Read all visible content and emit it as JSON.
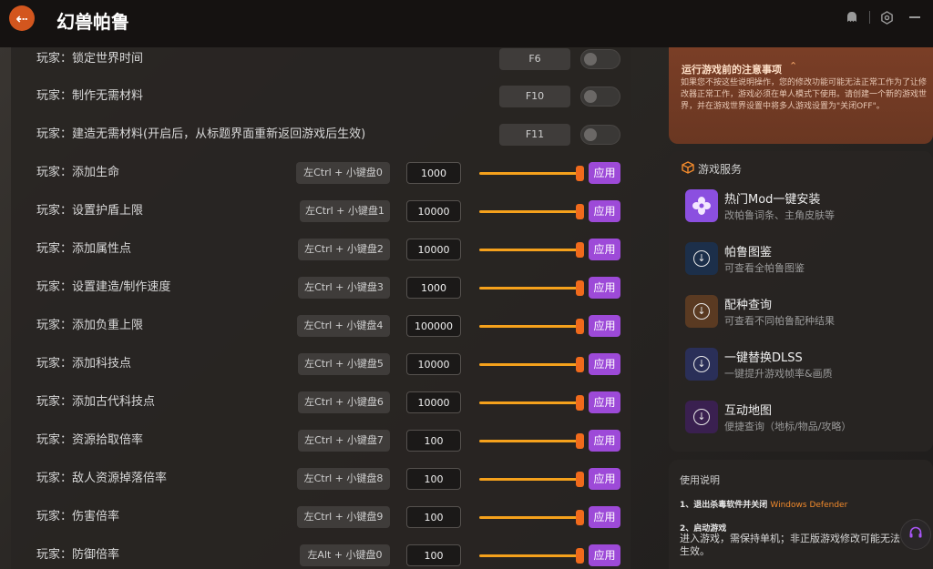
{
  "header": {
    "back_icon": "arrow-left-icon",
    "title": "幻兽帕鲁",
    "icons": [
      "ghost-icon",
      "settings-hex-icon",
      "minimize-icon"
    ]
  },
  "toggle_rows": [
    {
      "label": "玩家：锁定世界时间",
      "hotkey": "F6",
      "enabled": false
    },
    {
      "label": "玩家：制作无需材料",
      "hotkey": "F10",
      "enabled": false
    },
    {
      "label": "玩家：建造无需材料(开启后，从标题界面重新返回游戏后生效)",
      "hotkey": "F11",
      "enabled": false
    }
  ],
  "value_rows": [
    {
      "label": "玩家：添加生命",
      "hotkey": "左Ctrl + 小键盘0",
      "value": "1000",
      "slider": 1.0,
      "apply": "应用"
    },
    {
      "label": "玩家：设置护盾上限",
      "hotkey": "左Ctrl + 小键盘1",
      "value": "10000",
      "slider": 1.0,
      "apply": "应用"
    },
    {
      "label": "玩家：添加属性点",
      "hotkey": "左Ctrl + 小键盘2",
      "value": "10000",
      "slider": 1.0,
      "apply": "应用"
    },
    {
      "label": "玩家：设置建造/制作速度",
      "hotkey": "左Ctrl + 小键盘3",
      "value": "1000",
      "slider": 1.0,
      "apply": "应用"
    },
    {
      "label": "玩家：添加负重上限",
      "hotkey": "左Ctrl + 小键盘4",
      "value": "100000",
      "slider": 1.0,
      "apply": "应用"
    },
    {
      "label": "玩家：添加科技点",
      "hotkey": "左Ctrl + 小键盘5",
      "value": "10000",
      "slider": 1.0,
      "apply": "应用"
    },
    {
      "label": "玩家：添加古代科技点",
      "hotkey": "左Ctrl + 小键盘6",
      "value": "10000",
      "slider": 1.0,
      "apply": "应用"
    },
    {
      "label": "玩家：资源拾取倍率",
      "hotkey": "左Ctrl + 小键盘7",
      "value": "100",
      "slider": 1.0,
      "apply": "应用"
    },
    {
      "label": "玩家：敌人资源掉落倍率",
      "hotkey": "左Ctrl + 小键盘8",
      "value": "100",
      "slider": 1.0,
      "apply": "应用"
    },
    {
      "label": "玩家：伤害倍率",
      "hotkey": "左Ctrl + 小键盘9",
      "value": "100",
      "slider": 1.0,
      "apply": "应用"
    },
    {
      "label": "玩家：防御倍率",
      "hotkey": "左Alt + 小键盘0",
      "value": "100",
      "slider": 1.0,
      "apply": "应用"
    }
  ],
  "notice": {
    "title": "运行游戏前的注意事项",
    "icon": "chevron-up-icon",
    "body": "如果您不按这些说明操作，您的修改功能可能无法正常工作为了让修改器正常工作，游戏必须在单人模式下使用。请创建一个新的游戏世界，并在游戏世界设置中将多人游戏设置为\"关闭OFF\"。"
  },
  "services": {
    "header": "游戏服务",
    "header_icon": "box-icon",
    "items": [
      {
        "title": "热门Mod一键安装",
        "subtitle": "改帕鲁词条、主角皮肤等",
        "icon": "mod-flower-icon",
        "color": "#8b4fe0"
      },
      {
        "title": "帕鲁图鉴",
        "subtitle": "可查看全帕鲁图鉴",
        "icon": "download-icon",
        "color": "#1c2f4a"
      },
      {
        "title": "配种查询",
        "subtitle": "可查看不同帕鲁配种结果",
        "icon": "download-icon",
        "color": "#5a3a22"
      },
      {
        "title": "一键替换DLSS",
        "subtitle": "一键提升游戏帧率&画质",
        "icon": "download-icon",
        "color": "#2a2f58"
      },
      {
        "title": "互动地图",
        "subtitle": "便捷查询（地标/物品/攻略）",
        "icon": "download-icon",
        "color": "#3a2050"
      }
    ]
  },
  "usage": {
    "title": "使用说明",
    "step1_prefix": "1、退出杀毒软件并关闭",
    "step1_accent": "Windows Defender",
    "step2_title": "2、启动游戏",
    "step2_body": "进入游戏，需保持单机；非正版游戏修改可能无法生效。"
  },
  "support_icon": "headset-icon",
  "colors": {
    "accent_orange": "#f28a2c",
    "apply_purple": "#9d4ad8",
    "slider_orange": "#f5a11c"
  }
}
